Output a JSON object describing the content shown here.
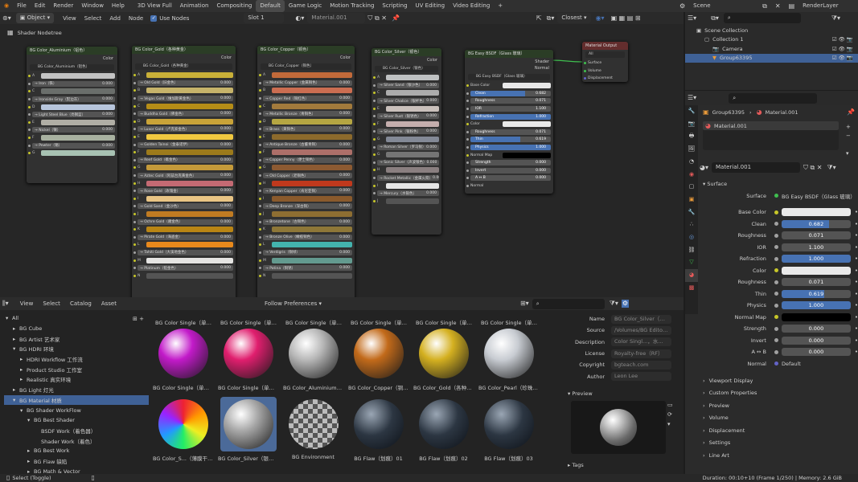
{
  "colors": {
    "accent": "#4772b3",
    "node_header": "#2b3d26",
    "output_header": "#632d2d",
    "selection": "#3f6196",
    "socket_yellow": "#c7c729"
  },
  "topbar": {
    "menus": [
      "File",
      "Edit",
      "Render",
      "Window",
      "Help"
    ],
    "workspaces": [
      "3D View Full",
      "Animation",
      "Compositing",
      "Default",
      "Game Logic",
      "Motion Tracking",
      "Scripting",
      "UV Editing",
      "Video Editing"
    ],
    "active_workspace": "Default",
    "scene": "Scene",
    "view_layer": "RenderLayer"
  },
  "node_header": {
    "mode": "Object",
    "menus": [
      "View",
      "Select",
      "Add",
      "Node"
    ],
    "use_nodes": "Use Nodes",
    "slot": "Slot 1",
    "material": "Material.001",
    "snap": "Closest"
  },
  "breadcrumb": "Shader Nodetree",
  "nodes": [
    {
      "title": "BG Color_Aluminium（铝色）",
      "out": "Color",
      "sub": "BG Color_Aluminium（铝色）",
      "rows": [
        [
          "A",
          ""
        ],
        [
          "",
          "→ Iron（铁）",
          "0.000"
        ],
        [
          "C",
          ""
        ],
        [
          "",
          "→ Ironside Gray（熨边灰）",
          "0.000"
        ],
        [
          "D",
          ""
        ],
        [
          "",
          "→ Light Steel Blue（亮钢蓝）",
          "0.000"
        ],
        [
          "E",
          ""
        ],
        [
          "",
          "→ Nickel（镍）",
          "0.000"
        ],
        [
          "F",
          ""
        ],
        [
          "",
          "→ Pewter（锡）",
          "0.000"
        ],
        [
          "G",
          ""
        ]
      ],
      "swatches": [
        "#c4c4c4",
        "#545454",
        "#6a6e6b",
        "#545454",
        "#b7c5dc",
        "#545454",
        "#b0aea5",
        "#545454",
        "#a8b1a0",
        "#545454",
        "#a8c2b3"
      ]
    },
    {
      "title": "BG Color_Gold（各种黄金）",
      "out": "Color",
      "sub": "BG Color_Gold（各种黄金）",
      "rows": [
        [
          "A",
          ""
        ],
        [
          "",
          "→ Old Gold（旧金色）",
          "0.000"
        ],
        [
          "B",
          ""
        ],
        [
          "",
          "→ Vegas Gold（维加斯黄金色）",
          "0.000"
        ],
        [
          "C",
          ""
        ],
        [
          "",
          "→ Buddha Gold（佛金色）",
          "0.000"
        ],
        [
          "D",
          ""
        ],
        [
          "",
          "→ Luxor Gold（卢克索金色）",
          "0.000"
        ],
        [
          "E",
          ""
        ],
        [
          "",
          "→ Golden Tainoi（金泰诺伊）",
          "0.000"
        ],
        [
          "F",
          ""
        ],
        [
          "",
          "→ Reef Gold（礁金色）",
          "0.000"
        ],
        [
          "G",
          ""
        ],
        [
          "",
          "→ Aztec Gold（阿兹台克黄金色）",
          "0.000"
        ],
        [
          "H",
          ""
        ],
        [
          "",
          "→ Rose Gold（玫瑰金）",
          "0.000"
        ],
        [
          "I",
          ""
        ],
        [
          "",
          "→ Gold Sand（金沙色）",
          "0.000"
        ],
        [
          "J",
          ""
        ],
        [
          "",
          "→ Ochre Gold（赭金色）",
          "0.000"
        ],
        [
          "K",
          ""
        ],
        [
          "",
          "→ Pirate Gold（海盗金）",
          "0.000"
        ],
        [
          "L",
          ""
        ],
        [
          "",
          "→ Tahiti Gold（大溪地金色）",
          "0.000"
        ],
        [
          "M",
          ""
        ],
        [
          "",
          "→ Platinum（铂金色）",
          "0.000"
        ],
        [
          "N",
          ""
        ]
      ],
      "swatches": [
        "#c9b038",
        "#545454",
        "#c6b36a",
        "#545454",
        "#b58d17",
        "#545454",
        "#c9a338",
        "#545454",
        "#f0c840",
        "#545454",
        "#9c7a1b",
        "#545454",
        "#c49a3a",
        "#545454",
        "#c46a73",
        "#545454",
        "#e8c484",
        "#545454",
        "#c07b22",
        "#545454",
        "#b98514",
        "#545454",
        "#e8891c",
        "#545454",
        "#e5e4e2"
      ]
    },
    {
      "title": "BG Color_Copper（铜色）",
      "out": "Color",
      "sub": "BG Color_Copper（铜色）",
      "rows": [
        [
          "A",
          ""
        ],
        [
          "",
          "→ Metallic Copper（金属铜色）",
          "0.000"
        ],
        [
          "B",
          ""
        ],
        [
          "",
          "→ Copper Red（铜红色）",
          "0.000"
        ],
        [
          "C",
          ""
        ],
        [
          "",
          "→ Metallic Bronze（青铜色）",
          "0.000"
        ],
        [
          "D",
          ""
        ],
        [
          "",
          "→ Brass（黄铜色）",
          "0.000"
        ],
        [
          "E",
          ""
        ],
        [
          "",
          "→ Antique Bronze（古董青铜）",
          "0.000"
        ],
        [
          "F",
          ""
        ],
        [
          "",
          "→ Copper Penny（便士铜色）",
          "0.000"
        ],
        [
          "G",
          ""
        ],
        [
          "",
          "→ Old Copper（老铜色）",
          "0.000"
        ],
        [
          "H",
          ""
        ],
        [
          "",
          "→ Kenyan Copper（肯尼亚铜）",
          "0.000"
        ],
        [
          "I",
          ""
        ],
        [
          "",
          "→ Deep Bronze（深古铜）",
          "0.000"
        ],
        [
          "J",
          ""
        ],
        [
          "",
          "→ Bronzetone（古铜色）",
          "0.000"
        ],
        [
          "K",
          ""
        ],
        [
          "",
          "→ Bronze Olive（橄榄铜色）",
          "0.000"
        ],
        [
          "L",
          ""
        ],
        [
          "",
          "→ Verdigris（铜绿）",
          "0.000"
        ],
        [
          "M",
          ""
        ],
        [
          "",
          "→ Patina（铜锈）",
          "0.000"
        ],
        [
          "N",
          ""
        ]
      ],
      "swatches": [
        "#c26a3a",
        "#545454",
        "#cb6d51",
        "#545454",
        "#a27a3c",
        "#545454",
        "#b5a642",
        "#545454",
        "#8c6a2c",
        "#545454",
        "#ad6f69",
        "#545454",
        "#8c5a32",
        "#545454",
        "#c0391d",
        "#545454",
        "#8a5a2c",
        "#545454",
        "#8e6e32",
        "#545454",
        "#8e7738",
        "#545454",
        "#43b3ae",
        "#545454",
        "#639a8f"
      ]
    },
    {
      "title": "BG Color_Silver（银色）",
      "out": "Color",
      "sub": "BG Color_Silver（银色）",
      "rows": [
        [
          "A",
          ""
        ],
        [
          "",
          "→ Silver Sand（银沙色）",
          "0.000"
        ],
        [
          "C",
          ""
        ],
        [
          "",
          "→ Silver Chalice（银杯色）",
          "0.000"
        ],
        [
          "E",
          ""
        ],
        [
          "",
          "→ Silver Rust（银锈色）",
          "0.000"
        ],
        [
          "F",
          ""
        ],
        [
          "",
          "→ Silver Pink（银粉色）",
          "0.000"
        ],
        [
          "G",
          ""
        ],
        [
          "",
          "→ Roman Silver（罗马银）",
          "0.000"
        ],
        [
          "G",
          ""
        ],
        [
          "",
          "→ Sonic Silver（声波银色）",
          "0.000"
        ],
        [
          "H",
          ""
        ],
        [
          "",
          "→ Rocket Metallic（金属火箭）",
          "0.000"
        ],
        [
          "I",
          ""
        ],
        [
          "",
          "→ Mercury（水银色）",
          "0.000"
        ],
        [
          "J",
          ""
        ]
      ],
      "swatches": [
        "#bfc1c2",
        "#545454",
        "#acacac",
        "#545454",
        "#c9c0bb",
        "#545454",
        "#c4aead",
        "#545454",
        "#838996",
        "#545454",
        "#757575",
        "#545454",
        "#8a7f80",
        "#545454",
        "#e5e5e5"
      ]
    }
  ],
  "bsdf_node": {
    "title": "BG Easy BSDF（Glass 玻璃）",
    "outs": [
      "Shader",
      "Normal"
    ],
    "sub": "BG Easy BSDF（Glass 玻璃）"
  },
  "output_node": {
    "title": "Material Output",
    "select": "All",
    "ins": [
      "Surface",
      "Volume",
      "Displacement"
    ]
  },
  "asset_header": {
    "menus": [
      "View",
      "Select",
      "Catalog",
      "Asset"
    ],
    "import": "Follow Preferences"
  },
  "asset_tree": [
    {
      "label": "All",
      "depth": 0,
      "arrow": "▾"
    },
    {
      "label": "BG Cube",
      "depth": 1,
      "arrow": "▸"
    },
    {
      "label": "BG Artist 艺术家",
      "depth": 1,
      "arrow": "▸"
    },
    {
      "label": "BG HDRI 环境",
      "depth": 1,
      "arrow": "▾"
    },
    {
      "label": "HDRI Workflow 工作流",
      "depth": 2,
      "arrow": "▸"
    },
    {
      "label": "Product Studio 工作室",
      "depth": 2,
      "arrow": "▸"
    },
    {
      "label": "Realistic 真实环境",
      "depth": 2,
      "arrow": "▸"
    },
    {
      "label": "BG Light 灯光",
      "depth": 1,
      "arrow": "▸"
    },
    {
      "label": "BG Material 材质",
      "depth": 1,
      "arrow": "▾",
      "selected": true
    },
    {
      "label": "BG Shader WorkFlow",
      "depth": 2,
      "arrow": "▾"
    },
    {
      "label": "BG Best Shader",
      "depth": 3,
      "arrow": "▾"
    },
    {
      "label": "BSDF Work（着色器）",
      "depth": 4,
      "arrow": ""
    },
    {
      "label": "Shader Work（着色）",
      "depth": 4,
      "arrow": ""
    },
    {
      "label": "BG Best Work",
      "depth": 3,
      "arrow": "▸"
    },
    {
      "label": "BG Flaw 缺陷",
      "depth": 3,
      "arrow": "▸"
    },
    {
      "label": "BG Math & Vector",
      "depth": 3,
      "arrow": "▸"
    }
  ],
  "assets_top_labels": [
    "BG Color Single（单彩）...",
    "BG Color Single（单彩）...",
    "BG Color Single（单彩）...",
    "BG Color Single（单彩）...",
    "BG Color Single（单彩）...",
    "BG Color Single（单彩）..."
  ],
  "assets": [
    {
      "label": "BG Color Single（单彩）...",
      "color": "#c21ac9"
    },
    {
      "label": "BG Color Single（单彩）...",
      "color": "#e01e6e"
    },
    {
      "label": "BG Color_Aluminium（...",
      "color": "#b8b8b8"
    },
    {
      "label": "BG Color_Copper（铜色）",
      "color": "#c26a1a"
    },
    {
      "label": "BG Color_Gold（各种黄...",
      "color": "#d4b020"
    },
    {
      "label": "BG Color_Pearl（珍珠色）",
      "color": "#c8ccd2"
    },
    {
      "label": "BG Color_S...（薄膜干涉）01",
      "color": "#7a3c9e"
    },
    {
      "label": "BG Color_Silver（银色）",
      "color": "#a9a9a9",
      "selected": true
    },
    {
      "label": "BG Environment",
      "color": "#6a6a6a"
    },
    {
      "label": "BG Flaw（划痕）01",
      "color": "#2c3642"
    },
    {
      "label": "BG Flaw（划痕）02",
      "color": "#2c3642"
    },
    {
      "label": "BG Flaw（划痕）03",
      "color": "#2c3642"
    }
  ],
  "asset_meta": {
    "rows": [
      [
        "Name",
        "BG Color_Silver（银色）"
      ],
      [
        "Source",
        "/Volumes/BG Editor ..."
      ],
      [
        "Description",
        "Color Singl...，水银色..."
      ],
      [
        "License",
        "Royalty-free（RF）"
      ],
      [
        "Copyright",
        "bgteach.com"
      ],
      [
        "Author",
        "Leon Lee"
      ]
    ],
    "preview": "Preview",
    "tags": "Tags"
  },
  "outliner": {
    "search": "",
    "items": [
      {
        "label": "Scene Collection",
        "depth": 0
      },
      {
        "label": "Collection 1",
        "depth": 1
      },
      {
        "label": "Camera",
        "depth": 2
      },
      {
        "label": "Group63395",
        "depth": 2,
        "selected": true
      }
    ]
  },
  "properties": {
    "object": "Group63395",
    "material": "Material.001",
    "slot": "Material.001",
    "datablock": "Material.001",
    "surface_section": "Surface",
    "surface_label": "Surface",
    "surface_value": "BG Easy BSDF（Glass 玻璃）",
    "fields": [
      {
        "label": "Base Color",
        "type": "color",
        "color": "#e9e9e9"
      },
      {
        "label": "Clean",
        "type": "bar",
        "value": "0.682",
        "fill": 0.682
      },
      {
        "label": "Roughness",
        "type": "num",
        "value": "0.071"
      },
      {
        "label": "IOR",
        "type": "num",
        "value": "1.100"
      },
      {
        "label": "Refraction",
        "type": "bar",
        "value": "1.000",
        "fill": 1.0
      },
      {
        "label": "Color",
        "type": "color",
        "color": "#e9e9e9"
      },
      {
        "label": "Roughness",
        "type": "num",
        "value": "0.071"
      },
      {
        "label": "Thin",
        "type": "bar",
        "value": "0.619",
        "fill": 0.619
      },
      {
        "label": "Physics",
        "type": "bar",
        "value": "1.000",
        "fill": 1.0
      },
      {
        "label": "Normal Map",
        "type": "color",
        "color": "#000000"
      },
      {
        "label": "Strength",
        "type": "num",
        "value": "0.000"
      },
      {
        "label": "Invert",
        "type": "num",
        "value": "0.000"
      },
      {
        "label": "A ↔ B",
        "type": "num",
        "value": "0.000"
      },
      {
        "label": "Normal",
        "type": "text",
        "value": "Default"
      }
    ],
    "sections": [
      "Viewport Display",
      "Custom Properties",
      "Preview",
      "Volume",
      "Displacement",
      "Settings",
      "Line Art"
    ]
  },
  "statusbar": {
    "left": "Select (Toggle)",
    "right": "Duration: 00:10+10 (Frame 1/250) | Memory: 2.6 GiB"
  }
}
